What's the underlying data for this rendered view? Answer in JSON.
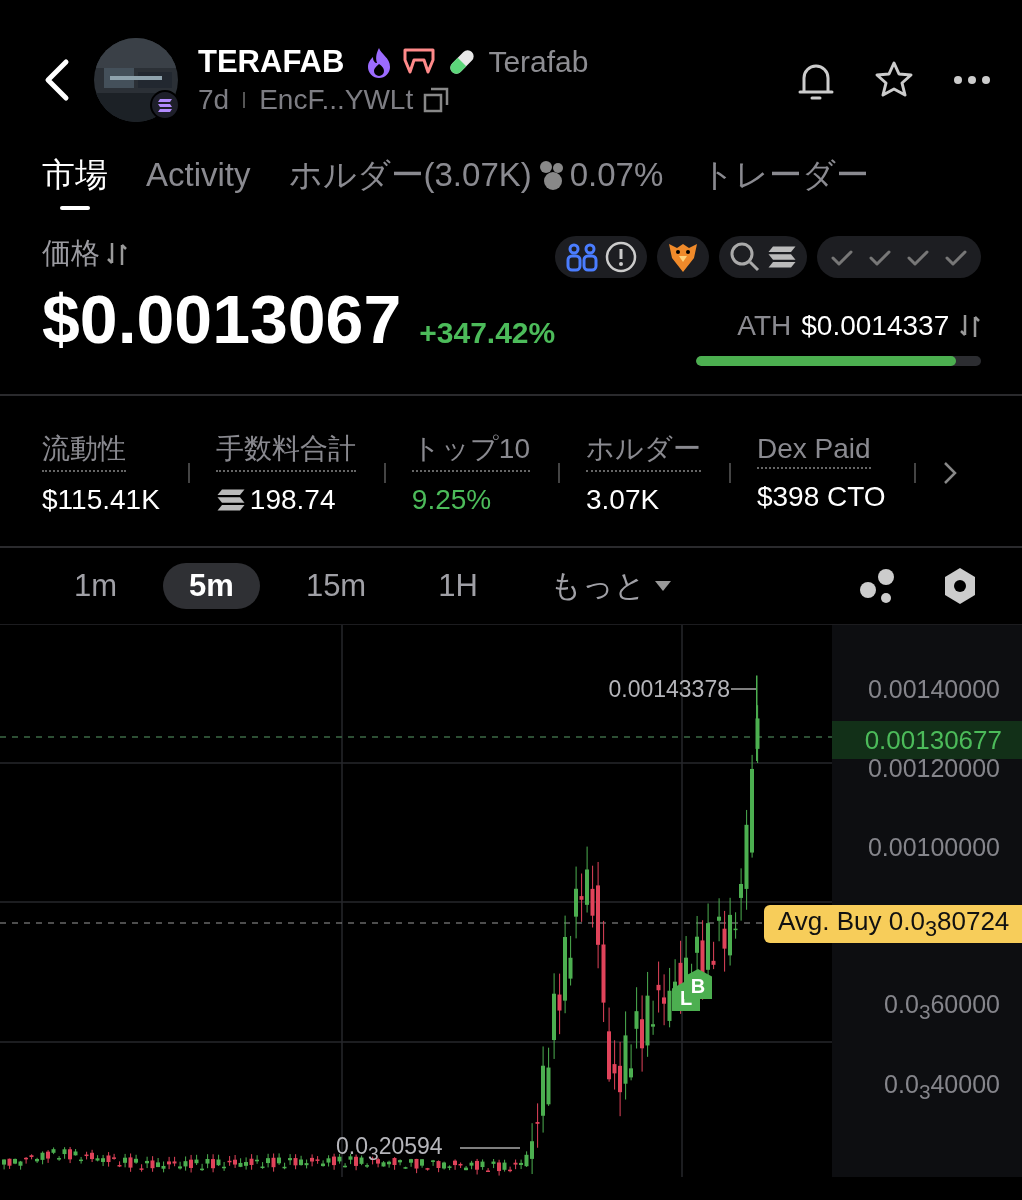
{
  "header": {
    "title": "TERAFAB",
    "tag": "Terafab",
    "age": "7d",
    "address": "EncF...YWLt"
  },
  "tabs": [
    {
      "label": "市場",
      "selected": true
    },
    {
      "label": "Activity",
      "selected": false
    },
    {
      "label": "ホルダー(3.07K)",
      "extra": "0.07%",
      "selected": false
    },
    {
      "label": "トレーダー",
      "selected": false
    }
  ],
  "price": {
    "label": "価格",
    "value": "$0.0013067",
    "change": "+347.42%",
    "ath_label": "ATH",
    "ath_value": "$0.0014337",
    "level": 0.91
  },
  "stats": [
    {
      "label": "流動性",
      "value": "$115.41K",
      "kind": "plain",
      "color": "#ffffff"
    },
    {
      "label": "手数料合計",
      "value": "198.74",
      "kind": "sol",
      "color": "#ffffff"
    },
    {
      "label": "トップ10",
      "value": "9.25%",
      "kind": "plain",
      "color": "#4cbb5a"
    },
    {
      "label": "ホルダー",
      "value": "3.07K",
      "kind": "plain",
      "color": "#ffffff"
    },
    {
      "label": "Dex Paid",
      "value": "$398 CTO",
      "kind": "plain",
      "color": "#ffffff"
    }
  ],
  "timeframes": [
    {
      "label": "1m",
      "selected": false,
      "kind": "option"
    },
    {
      "label": "5m",
      "selected": true,
      "kind": "option"
    },
    {
      "label": "15m",
      "selected": false,
      "kind": "option"
    },
    {
      "label": "1H",
      "selected": false,
      "kind": "option"
    },
    {
      "label": "もっと",
      "selected": false,
      "kind": "menu"
    }
  ],
  "chart": {
    "axis_labels": [
      "0.00140000",
      "0.00120000",
      "0.00100000",
      "0.0$_{3}$60000",
      "0.0$_{3}$40000"
    ],
    "current_price": "0.00130677",
    "avg_buy": "Avg. Buy 0.0$_{3}$80724",
    "high": "0.00143378",
    "low": "0.0$_{3}$20594",
    "markers": [
      {
        "label": "L"
      },
      {
        "label": "B"
      }
    ]
  }
}
